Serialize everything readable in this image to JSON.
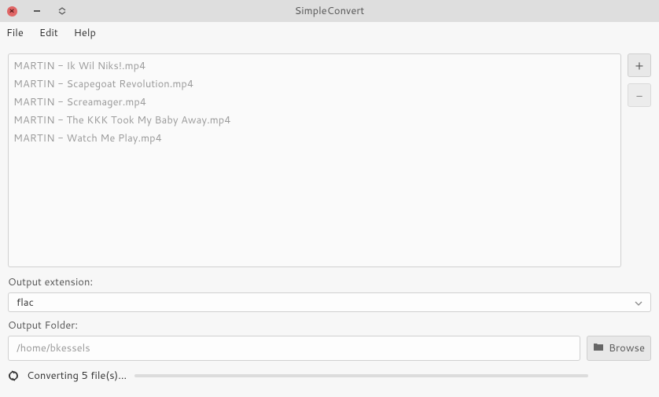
{
  "window": {
    "title": "SimpleConvert"
  },
  "menu": {
    "items": [
      {
        "label": "File"
      },
      {
        "label": "Edit"
      },
      {
        "label": "Help"
      }
    ]
  },
  "files": [
    "MARTIN - Ik Wil Niks!.mp4",
    "MARTIN - Scapegoat Revolution.mp4",
    "MARTIN - Screamager.mp4",
    "MARTIN - The KKK Took My Baby Away.mp4",
    "MARTIN - Watch Me Play.mp4"
  ],
  "side_buttons": {
    "add": "+",
    "remove": "−"
  },
  "labels": {
    "output_extension": "Output extension:",
    "output_folder": "Output Folder:"
  },
  "extension": {
    "value": "flac"
  },
  "folder": {
    "value": "/home/bkessels"
  },
  "browse": {
    "label": "Browse"
  },
  "status": {
    "text": "Converting 5 file(s)...",
    "progress_percent": 0
  }
}
